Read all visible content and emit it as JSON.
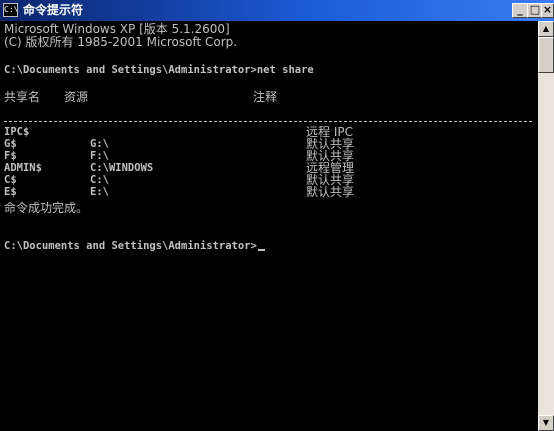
{
  "window": {
    "icon_text": "C:\\",
    "title": "命令提示符",
    "buttons": {
      "minimize": "_",
      "maximize": "□",
      "close": "×"
    }
  },
  "console": {
    "banner": [
      "Microsoft Windows XP [版本 5.1.2600]",
      "(C) 版权所有 1985-2001 Microsoft Corp."
    ],
    "prompt1": "C:\\Documents and Settings\\Administrator>net share",
    "headers": {
      "share": "共享名",
      "resource": "资源",
      "remark": "注释"
    },
    "shares": [
      {
        "name": "IPC$",
        "resource": "",
        "remark": "远程 IPC"
      },
      {
        "name": "G$",
        "resource": "G:\\",
        "remark": "默认共享"
      },
      {
        "name": "F$",
        "resource": "F:\\",
        "remark": "默认共享"
      },
      {
        "name": "ADMIN$",
        "resource": "C:\\WINDOWS",
        "remark": "远程管理"
      },
      {
        "name": "C$",
        "resource": "C:\\",
        "remark": "默认共享"
      },
      {
        "name": "E$",
        "resource": "E:\\",
        "remark": "默认共享"
      }
    ],
    "completion": "命令成功完成。",
    "prompt2": "C:\\Documents and Settings\\Administrator>"
  },
  "scrollbar": {
    "up_icon": "▲",
    "down_icon": "▼"
  }
}
